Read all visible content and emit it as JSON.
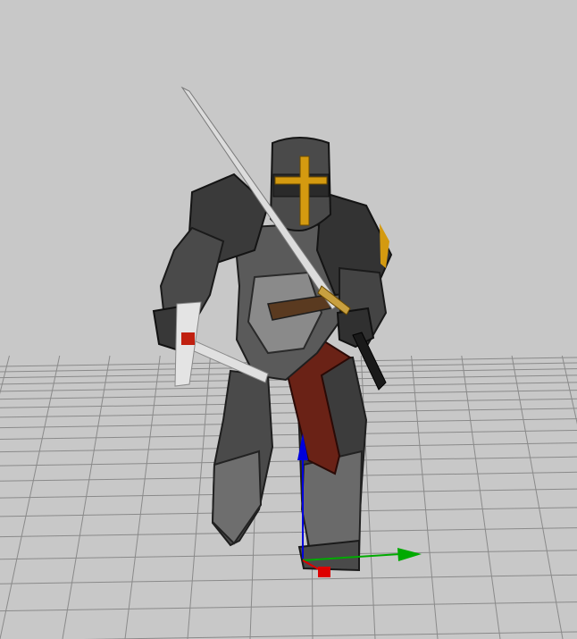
{
  "viewport": {
    "background_color": "#c8c8c8",
    "grid_color": "#8a8a8a",
    "object": "knight-model",
    "object_colors": {
      "armor_dark": "#2e2e2e",
      "armor_mid": "#5a5a5a",
      "armor_light": "#9a9a9a",
      "cloth_red": "#6a2216",
      "helmet_trim": "#d49a10",
      "blade": "#dcdcdc"
    }
  },
  "gizmo": {
    "x_axis_color": "#dd0000",
    "y_axis_color": "#00aa00",
    "z_axis_color": "#0000dd"
  }
}
